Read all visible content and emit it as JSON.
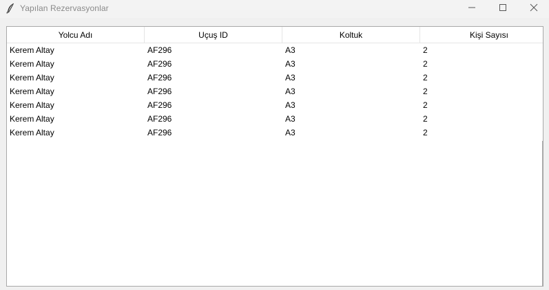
{
  "window": {
    "title": "Yapılan Rezervasyonlar",
    "icon": "feather-icon",
    "controls": {
      "minimize_icon": "minimize-icon",
      "maximize_icon": "maximize-icon",
      "close_icon": "close-icon"
    }
  },
  "table": {
    "columns": [
      "Yolcu Adı",
      "Uçuş ID",
      "Koltuk",
      "Kişi Sayısı"
    ],
    "rows": [
      [
        "Kerem Altay",
        "AF296",
        "A3",
        "2"
      ],
      [
        "Kerem Altay",
        "AF296",
        "A3",
        "2"
      ],
      [
        "Kerem Altay",
        "AF296",
        "A3",
        "2"
      ],
      [
        "Kerem Altay",
        "AF296",
        "A3",
        "2"
      ],
      [
        "Kerem Altay",
        "AF296",
        "A3",
        "2"
      ],
      [
        "Kerem Altay",
        "AF296",
        "A3",
        "2"
      ],
      [
        "Kerem Altay",
        "AF296",
        "A3",
        "2"
      ]
    ]
  }
}
